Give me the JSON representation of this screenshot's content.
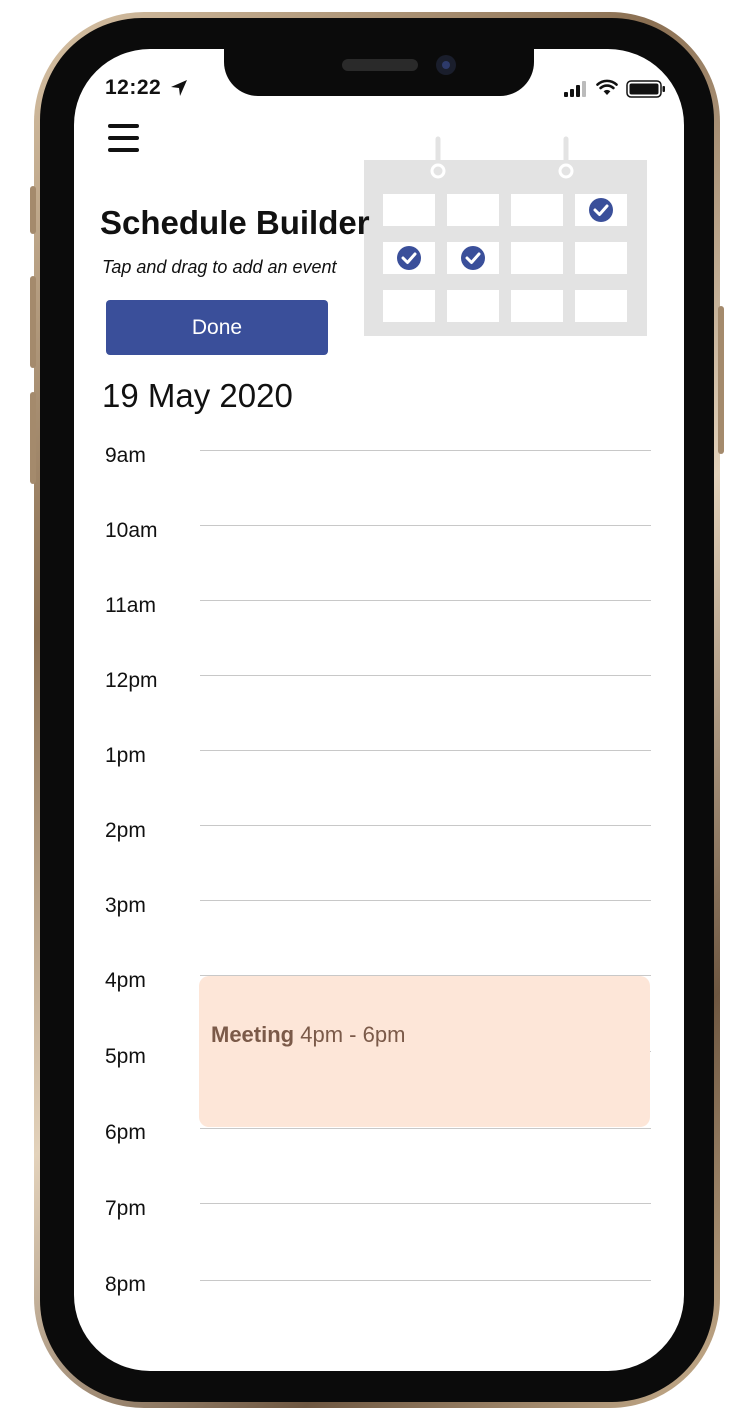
{
  "status_bar": {
    "time": "12:22"
  },
  "header": {
    "title": "Schedule Builder",
    "subtitle": "Tap and drag to add an event",
    "done_label": "Done"
  },
  "date": "19 May 2020",
  "hours": [
    "9am",
    "10am",
    "11am",
    "12pm",
    "1pm",
    "2pm",
    "3pm",
    "4pm",
    "5pm",
    "6pm",
    "7pm",
    "8pm"
  ],
  "event": {
    "name": "Meeting",
    "time": "4pm - 6pm"
  },
  "colors": {
    "accent": "#3a4f9a",
    "event_bg": "#fde6d8",
    "event_text": "#7b5a49",
    "illustration": "#e3e3e3"
  },
  "icons": [
    "menu-icon",
    "location-arrow-icon",
    "signal-icon",
    "wifi-icon",
    "battery-icon",
    "calendar-illustration"
  ]
}
